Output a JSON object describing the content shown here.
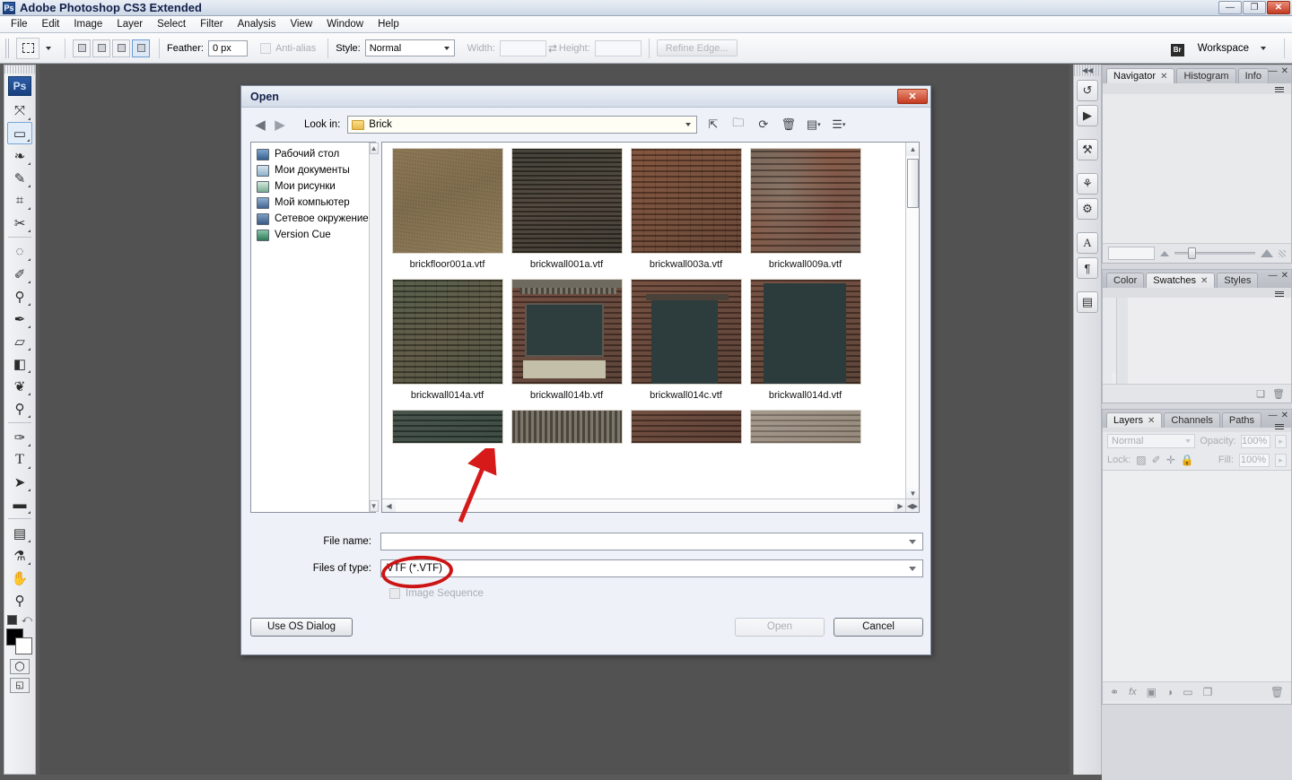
{
  "window": {
    "title": "Adobe Photoshop CS3 Extended",
    "app_icon": "Ps",
    "minimize": "—",
    "restore": "❐",
    "close": "✕"
  },
  "menubar": {
    "items": [
      "File",
      "Edit",
      "Image",
      "Layer",
      "Select",
      "Filter",
      "Analysis",
      "View",
      "Window",
      "Help"
    ]
  },
  "options_bar": {
    "feather_label": "Feather:",
    "feather_value": "0 px",
    "antialias_label": "Anti-alias",
    "style_label": "Style:",
    "style_value": "Normal",
    "width_label": "Width:",
    "width_value": "",
    "height_label": "Height:",
    "height_value": "",
    "refine_edge_label": "Refine Edge...",
    "workspace_label": "Workspace",
    "bridge_icon": "Br"
  },
  "toolbar": {
    "badge": "Ps",
    "tools": [
      {
        "name": "move-tool",
        "glyph": "✥"
      },
      {
        "name": "rectangular-marquee-tool",
        "glyph": "⬚",
        "selected": true
      },
      {
        "name": "lasso-tool",
        "glyph": "❀"
      },
      {
        "name": "magic-wand-tool",
        "glyph": "✦"
      },
      {
        "name": "crop-tool",
        "glyph": "⌗"
      },
      {
        "name": "slice-tool",
        "glyph": "✄"
      },
      {
        "name": "healing-brush-tool",
        "glyph": "◌"
      },
      {
        "name": "brush-tool",
        "glyph": "✐"
      },
      {
        "name": "clone-stamp-tool",
        "glyph": "⚙"
      },
      {
        "name": "history-brush-tool",
        "glyph": "✒"
      },
      {
        "name": "eraser-tool",
        "glyph": "▱"
      },
      {
        "name": "gradient-tool",
        "glyph": "◧"
      },
      {
        "name": "blur-tool",
        "glyph": "❦"
      },
      {
        "name": "dodge-tool",
        "glyph": "⚲"
      },
      {
        "name": "pen-tool",
        "glyph": "✒"
      },
      {
        "name": "type-tool",
        "glyph": "T"
      },
      {
        "name": "path-selection-tool",
        "glyph": "➤"
      },
      {
        "name": "rectangle-shape-tool",
        "glyph": "■"
      },
      {
        "name": "notes-tool",
        "glyph": "☰"
      },
      {
        "name": "eyedropper-tool",
        "glyph": "⚗"
      },
      {
        "name": "hand-tool",
        "glyph": "✋"
      },
      {
        "name": "zoom-tool",
        "glyph": "⚲"
      }
    ],
    "foreground_color": "#000000",
    "background_color": "#ffffff",
    "quickmask_icon": "◯",
    "screenmode_icon": "◰"
  },
  "icon_dock": {
    "items": [
      {
        "name": "history-icon",
        "glyph": "↺"
      },
      {
        "name": "actions-icon",
        "glyph": "▶"
      },
      {
        "name": "tool-presets-icon",
        "glyph": "⚒"
      },
      {
        "name": "brushes-icon",
        "glyph": "⚘"
      },
      {
        "name": "clone-source-icon",
        "glyph": "⚙"
      },
      {
        "name": "character-icon",
        "glyph": "A"
      },
      {
        "name": "paragraph-icon",
        "glyph": "¶"
      },
      {
        "name": "layer-comps-icon",
        "glyph": "☷"
      }
    ]
  },
  "panels": {
    "navigator_group": {
      "tabs": [
        {
          "label": "Navigator",
          "active": true,
          "closable": true
        },
        {
          "label": "Histogram",
          "active": false,
          "closable": false
        },
        {
          "label": "Info",
          "active": false,
          "closable": false
        }
      ],
      "zoom_value": ""
    },
    "color_group": {
      "tabs": [
        {
          "label": "Color",
          "active": false,
          "closable": false
        },
        {
          "label": "Swatches",
          "active": true,
          "closable": true
        },
        {
          "label": "Styles",
          "active": false,
          "closable": false
        }
      ],
      "swatch_colors": [
        "#ff0000",
        "#ffff00",
        "#00ff00",
        "#00ffff",
        "#0000ff",
        "#ff00ff",
        "#ffffff",
        "#f2f2f2",
        "#e6e6e6",
        "#d9d9d9",
        "#cccccc",
        "#bfbfbf",
        "#b3b3b3",
        "#a6a6a6",
        "#999999",
        "#e50000",
        "#e5e500",
        "#00b200",
        "#0099e5",
        "#3333b2",
        "#e5007f",
        "#8c8c8c",
        "#808080",
        "#737373",
        "#666666",
        "#595959",
        "#4d4d4d",
        "#333333",
        "#1a1a1a",
        "#000000",
        "#f2b8a0",
        "#f2cc9e",
        "#f2e8a8",
        "#ccdda0",
        "#a8d9b8",
        "#a0d9d9",
        "#8ccbf2",
        "#a0b8e5",
        "#b0a8de",
        "#c9a8de",
        "#deb0d9",
        "#e5a8bf",
        "#f2b0b0",
        "#f2c4b8",
        "#f2d9c4",
        "#f08a66",
        "#f0a866",
        "#f0dd73",
        "#b8d973",
        "#80cc99",
        "#66c4cc",
        "#4db3f0",
        "#6699e0",
        "#8273d9",
        "#ab73d9",
        "#d973cc",
        "#e06699",
        "#f06680",
        "#f08a80",
        "#f0b28c",
        "#e53d1f",
        "#e5751f",
        "#e5cc1f",
        "#99cc1f",
        "#33b35c",
        "#1fa8b3",
        "#1f8ce5",
        "#2b63cc",
        "#4a33cc",
        "#8c2bcc",
        "#cc2bb3",
        "#cc1f73",
        "#e51f4d",
        "#e5543d",
        "#e58c5c",
        "#b3300f",
        "#b3550f",
        "#99990f",
        "#5c990f",
        "#0f8c3d",
        "#0f8091",
        "#0f66b3",
        "#1a3d99",
        "#2b1a99",
        "#6b1a99",
        "#991a85",
        "#990f55",
        "#b30f33",
        "#b33a26",
        "#b3663d",
        "#801f08",
        "#803d08",
        "#6b6b08",
        "#3d6b08",
        "#086b2b",
        "#085c6b",
        "#084a80",
        "#0f2b6b",
        "#1f0f6b",
        "#4d0f6b",
        "#6b0f5c",
        "#6b083d",
        "#800822",
        "#801f14",
        "#804a22",
        "#d9c9a8",
        "#a89c8c",
        "#8c7f70",
        "#4d463d",
        "#33302b",
        "#d9a066",
        "#c98c55",
        "#b37a47",
        "#99663d",
        "#8c5c33",
        "",
        "",
        "",
        "",
        ""
      ]
    },
    "layers_group": {
      "tabs": [
        {
          "label": "Layers",
          "active": true,
          "closable": true
        },
        {
          "label": "Channels",
          "active": false,
          "closable": false
        },
        {
          "label": "Paths",
          "active": false,
          "closable": false
        }
      ],
      "blend_mode": "Normal",
      "opacity_label": "Opacity:",
      "opacity_value": "100%",
      "lock_label": "Lock:",
      "fill_label": "Fill:",
      "fill_value": "100%",
      "lock_icons": [
        {
          "name": "lock-transparent-pixels-icon",
          "glyph": "▨"
        },
        {
          "name": "lock-image-pixels-icon",
          "glyph": "✐"
        },
        {
          "name": "lock-position-icon",
          "glyph": "✥"
        },
        {
          "name": "lock-all-icon",
          "glyph": "ὑ2"
        }
      ],
      "footer_icons": [
        {
          "name": "link-layers-icon",
          "glyph": "⚭"
        },
        {
          "name": "layer-style-icon",
          "glyph": "fx"
        },
        {
          "name": "layer-mask-icon",
          "glyph": "▣"
        },
        {
          "name": "adjustment-layer-icon",
          "glyph": "◑"
        },
        {
          "name": "new-group-icon",
          "glyph": "▭"
        },
        {
          "name": "new-layer-icon",
          "glyph": "❐"
        },
        {
          "name": "delete-layer-icon",
          "glyph": "Ὕ1"
        }
      ]
    }
  },
  "open_dialog": {
    "title": "Open",
    "close_label": "✕",
    "back_arrow": "◀",
    "forward_arrow": "▶",
    "lookin_label": "Look in:",
    "lookin_value": "Brick",
    "toolbar_icons": [
      {
        "name": "up-one-level-icon",
        "glyph": "⤒"
      },
      {
        "name": "create-new-folder-icon",
        "glyph": "὜0"
      },
      {
        "name": "refresh-icon",
        "glyph": "⟳"
      },
      {
        "name": "delete-icon",
        "glyph": "Ὕ1"
      },
      {
        "name": "view-mode-icon",
        "glyph": "☷"
      },
      {
        "name": "list-view-icon",
        "glyph": "☰"
      }
    ],
    "places": [
      {
        "label": "Рабочий стол",
        "icon": "desktop-icon",
        "color": "#4a6fa5"
      },
      {
        "label": "Мои документы",
        "icon": "my-documents-icon",
        "color": "#7ea8c4"
      },
      {
        "label": "Мои рисунки",
        "icon": "my-pictures-icon",
        "color": "#6fa890"
      },
      {
        "label": "Мой компьютер",
        "icon": "my-computer-icon",
        "color": "#5b7fa8"
      },
      {
        "label": "Сетевое окружение",
        "icon": "network-places-icon",
        "color": "#4f6f9c"
      },
      {
        "label": "Version Cue",
        "icon": "version-cue-icon",
        "color": "#4f9e7a"
      }
    ],
    "files": [
      {
        "name": "brickfloor001a.vtf",
        "thumb": "brick-floor-tan"
      },
      {
        "name": "brickwall001a.vtf",
        "thumb": "brick-wall-dark"
      },
      {
        "name": "brickwall003a.vtf",
        "thumb": "brick-wall-red"
      },
      {
        "name": "brickwall009a.vtf",
        "thumb": "brick-wall-mottled"
      },
      {
        "name": "brickwall014a.vtf",
        "thumb": "brick-wall-green"
      },
      {
        "name": "brickwall014b.vtf",
        "thumb": "brick-window"
      },
      {
        "name": "brickwall014c.vtf",
        "thumb": "brick-door-dark"
      },
      {
        "name": "brickwall014d.vtf",
        "thumb": "brick-door-wide"
      }
    ],
    "filename_label": "File name:",
    "filename_value": "",
    "filetype_label": "Files of type:",
    "filetype_value": "VTF (*.VTF)",
    "image_sequence_label": "Image Sequence",
    "image_sequence_checked": false,
    "use_os_dialog_label": "Use OS Dialog",
    "open_label": "Open",
    "open_disabled": true,
    "cancel_label": "Cancel"
  },
  "annotations": {
    "ellipse_color": "#cc1414",
    "arrow_color": "#d61a1a",
    "ellipse_target": "filetype-field",
    "arrow_target": "brickwall014a-thumbnail"
  }
}
